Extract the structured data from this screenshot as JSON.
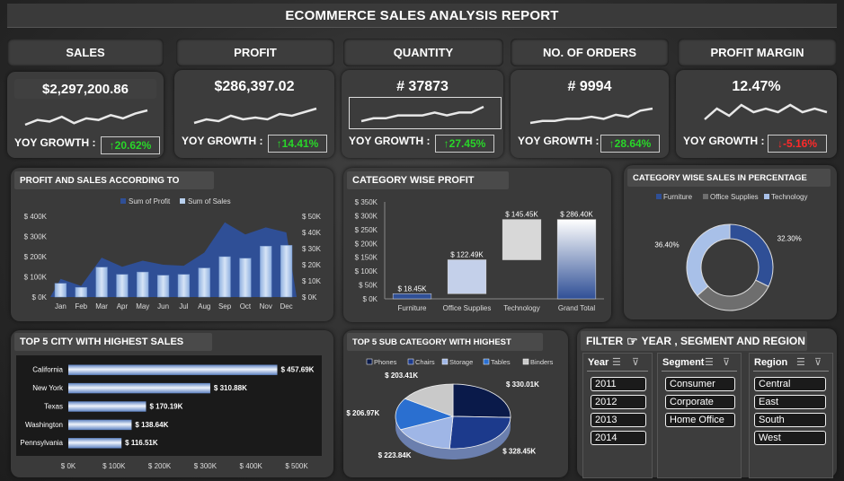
{
  "report_title": "ECOMMERCE SALES ANALYSIS REPORT",
  "kpis": [
    {
      "label": "SALES",
      "value": "$2,297,200.86",
      "yoy_label": "YOY GROWTH :",
      "yoy": "↑20.62%",
      "direction": "up",
      "spark": [
        3,
        6,
        5,
        8,
        4,
        7,
        6,
        9,
        7,
        10,
        12
      ]
    },
    {
      "label": "PROFIT",
      "value": "$286,397.02",
      "yoy_label": "YOY GROWTH :",
      "yoy": "↑14.41%",
      "direction": "up",
      "spark": [
        3,
        5,
        4,
        7,
        5,
        6,
        5,
        8,
        7,
        9,
        11
      ]
    },
    {
      "label": "QUANTITY",
      "value": "# 37873",
      "yoy_label": "YOY GROWTH :",
      "yoy": "↑27.45%",
      "direction": "up",
      "spark": [
        5,
        6,
        6,
        7,
        7,
        7,
        8,
        7,
        8,
        8,
        10
      ]
    },
    {
      "label": "NO. OF ORDERS",
      "value": "# 9994",
      "yoy_label": "YOY GROWTH :",
      "yoy": "↑28.64%",
      "direction": "up",
      "spark": [
        3,
        4,
        4,
        5,
        5,
        6,
        5,
        7,
        6,
        9,
        10
      ]
    },
    {
      "label": "PROFIT MARGIN",
      "value": "12.47%",
      "yoy_label": "YOY GROWTH :",
      "yoy": "↓-5.16%",
      "direction": "down",
      "spark": [
        6,
        9,
        7,
        10,
        8,
        9,
        8,
        10,
        8,
        9,
        8
      ]
    }
  ],
  "panels": {
    "monthly": "PROFIT AND SALES ACCORDING TO",
    "category_profit": "CATEGORY WISE PROFIT",
    "category_sales_pct": "CATEGORY WISE SALES IN PERCENTAGE",
    "top_city": "TOP 5 CITY WITH HIGHEST SALES",
    "top_subcat": "TOP 5 SUB CATEGORY WITH HIGHEST"
  },
  "filter": {
    "title": "FILTER",
    "title_rest": "YEAR , SEGMENT AND REGION",
    "year_label": "Year",
    "years": [
      "2011",
      "2012",
      "2013",
      "2014"
    ],
    "segment_label": "Segment",
    "segments": [
      "Consumer",
      "Corporate",
      "Home Office"
    ],
    "region_label": "Region",
    "regions": [
      "Central",
      "East",
      "South",
      "West"
    ]
  },
  "colors": {
    "up": "#29d629",
    "down": "#ff2a2a",
    "dark_blue": "#2f4f96",
    "light_blue": "#b8d0ee"
  },
  "chart_data": [
    {
      "type": "area",
      "legend_position": "top",
      "categories": [
        "Jan",
        "Feb",
        "Mar",
        "Apr",
        "May",
        "Jun",
        "Jul",
        "Aug",
        "Sep",
        "Oct",
        "Nov",
        "Dec"
      ],
      "series": [
        {
          "name": "Sum of Profit",
          "axis": "left",
          "kind": "area",
          "values": [
            90000,
            55000,
            195000,
            150000,
            180000,
            160000,
            155000,
            220000,
            370000,
            310000,
            345000,
            320000
          ]
        },
        {
          "name": "Sum of Sales",
          "axis": "right",
          "kind": "bar",
          "values": [
            8500,
            6000,
            18500,
            14000,
            15500,
            13500,
            14000,
            18000,
            25000,
            24000,
            31500,
            32000
          ]
        }
      ],
      "left_ticks": [
        "$ 0K",
        "$ 100K",
        "$ 200K",
        "$ 300K",
        "$ 400K"
      ],
      "right_ticks": [
        "$ 0K",
        "$ 10K",
        "$ 20K",
        "$ 30K",
        "$ 40K",
        "$ 50K"
      ],
      "ylim_left": [
        0,
        400000
      ],
      "ylim_right": [
        0,
        50000
      ]
    },
    {
      "type": "bar",
      "subtype": "waterfall",
      "categories": [
        "Furniture",
        "Office Supplies",
        "Technology",
        "Grand Total"
      ],
      "values": [
        18450,
        122490,
        145450,
        286400
      ],
      "labels": [
        "$ 18.45K",
        "$ 122.49K",
        "$ 145.45K",
        "$ 286.40K"
      ],
      "y_ticks": [
        "$ 0K",
        "$ 50K",
        "$ 100K",
        "$ 150K",
        "$ 200K",
        "$ 250K",
        "$ 300K",
        "$ 350K"
      ],
      "ylim": [
        0,
        350000
      ]
    },
    {
      "type": "pie",
      "subtype": "donut",
      "categories": [
        "Furniture",
        "Office Supplies",
        "Technology"
      ],
      "values": [
        32.3,
        31.3,
        36.4
      ],
      "labels": [
        "32.30%",
        "31.30%",
        "36.40%"
      ],
      "colors": [
        "#2f4f96",
        "#6e6e6e",
        "#a8c0e8"
      ],
      "legend_position": "top"
    },
    {
      "type": "bar",
      "orientation": "horizontal",
      "categories": [
        "California",
        "New York",
        "Texas",
        "Washington",
        "Pennsylvania"
      ],
      "values": [
        457690,
        310880,
        170190,
        138640,
        116510
      ],
      "labels": [
        "$ 457.69K",
        "$ 310.88K",
        "$ 170.19K",
        "$ 138.64K",
        "$ 116.51K"
      ],
      "x_ticks": [
        "$ 0K",
        "$ 100K",
        "$ 200K",
        "$ 300K",
        "$ 400K",
        "$ 500K"
      ],
      "xlim": [
        0,
        500000
      ]
    },
    {
      "type": "pie",
      "subtype": "3d",
      "categories": [
        "Phones",
        "Chairs",
        "Storage",
        "Tables",
        "Binders"
      ],
      "values": [
        330010,
        328450,
        223840,
        206970,
        203410
      ],
      "labels": [
        "$ 330.01K",
        "$ 328.45K",
        "$ 223.84K",
        "$ 206.97K",
        "$ 203.41K"
      ],
      "colors": [
        "#0a1a4a",
        "#1c3a8c",
        "#9fb6e6",
        "#2a6fd0",
        "#c9c9c9"
      ],
      "legend_position": "top"
    }
  ]
}
